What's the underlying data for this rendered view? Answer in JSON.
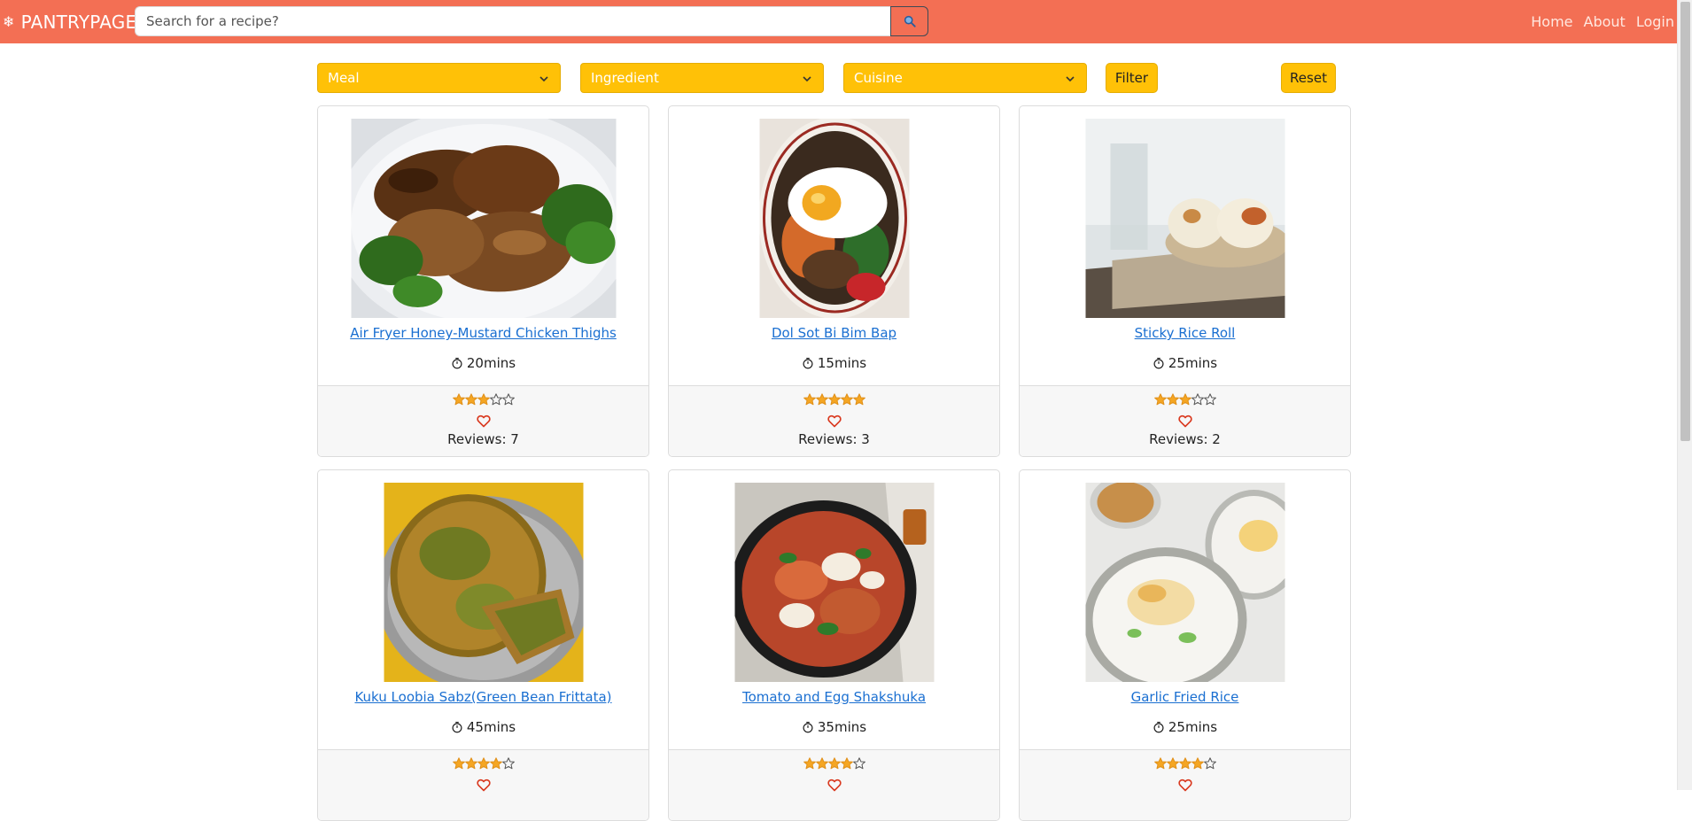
{
  "brand": {
    "icon": "snowflake-icon",
    "name": "PANTRYPAGE"
  },
  "search": {
    "placeholder": "Search for a recipe?",
    "value": "",
    "button_icon": "search-icon"
  },
  "nav": [
    {
      "label": "Home"
    },
    {
      "label": "About"
    },
    {
      "label": "Login"
    }
  ],
  "filters": {
    "meal": "Meal",
    "ingredient": "Ingredient",
    "cuisine": "Cuisine",
    "filter_label": "Filter",
    "reset_label": "Reset"
  },
  "colors": {
    "navbar": "#f36f54",
    "accent_yellow": "#ffc107",
    "link_blue": "#1a6fd1",
    "star_orange": "#f5a623",
    "heart_red": "#d9381e"
  },
  "recipes": [
    {
      "title": "Air Fryer Honey-Mustard Chicken Thighs",
      "time": "20mins",
      "rating": 3,
      "reviews_text": "Reviews: 7",
      "favorited": false
    },
    {
      "title": "Dol Sot Bi Bim Bap",
      "time": "15mins",
      "rating": 5,
      "reviews_text": "Reviews: 3",
      "favorited": false
    },
    {
      "title": "Sticky Rice Roll",
      "time": "25mins",
      "rating": 3,
      "reviews_text": "Reviews: 2",
      "favorited": false
    },
    {
      "title": "Kuku Loobia Sabz(Green Bean Frittata)",
      "time": "45mins",
      "rating": 4,
      "reviews_text": "",
      "favorited": false
    },
    {
      "title": "Tomato and Egg Shakshuka",
      "time": "35mins",
      "rating": 4,
      "reviews_text": "",
      "favorited": false
    },
    {
      "title": "Garlic Fried Rice",
      "time": "25mins",
      "rating": 4,
      "reviews_text": "",
      "favorited": false
    }
  ]
}
